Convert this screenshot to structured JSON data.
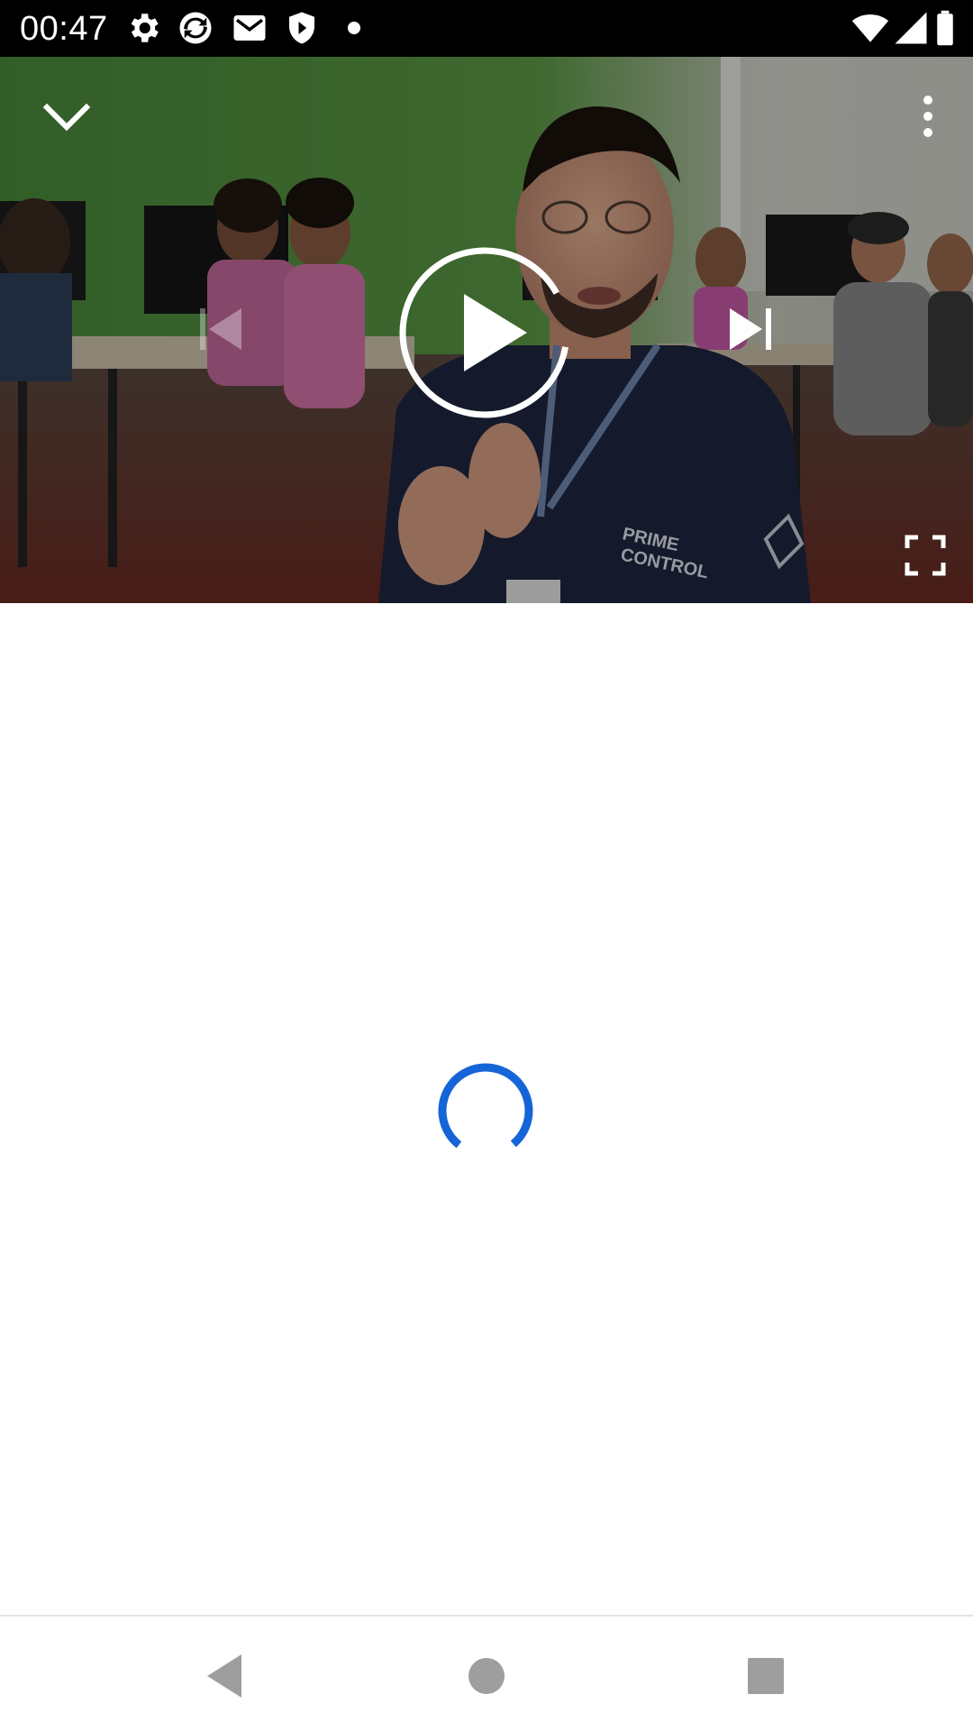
{
  "status_bar": {
    "time": "00:47",
    "left_icons": [
      "settings-icon",
      "sync-icon",
      "gmail-icon",
      "shield-play-icon",
      "dot-icon"
    ],
    "right_icons": [
      "wifi-icon",
      "signal-icon",
      "battery-icon"
    ]
  },
  "video_player": {
    "controls": {
      "collapse": "chevron-down-icon",
      "more": "more-vertical-icon",
      "previous": "skip-previous-icon",
      "play": "play-icon",
      "next": "skip-next-icon",
      "fullscreen": "fullscreen-icon"
    },
    "previous_enabled": false,
    "scene_text": {
      "shirt_line1": "PRIME",
      "shirt_line2": "CONTROL"
    }
  },
  "content": {
    "state": "loading",
    "spinner_color": "#1565d8"
  },
  "nav_bar": {
    "buttons": [
      "back-icon",
      "home-icon",
      "recents-icon"
    ]
  },
  "colors": {
    "status_bar_bg": "#000000",
    "accent": "#1565d8",
    "nav_icon": "#9e9e9e"
  }
}
